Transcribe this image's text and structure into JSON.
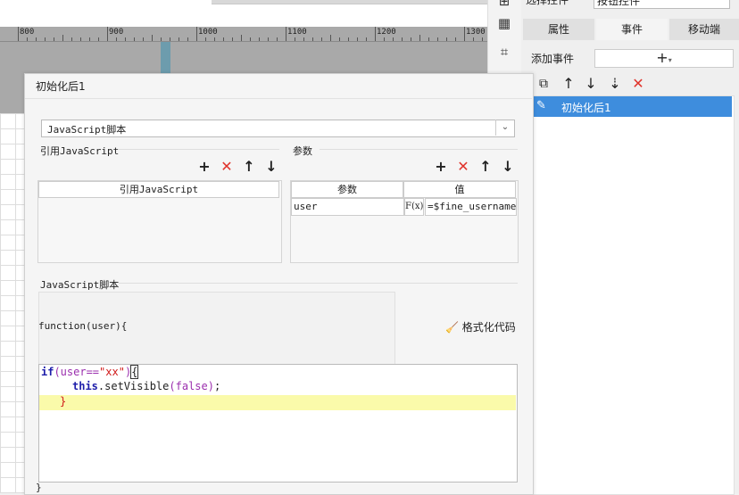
{
  "ruler": {
    "labels": [
      "800",
      "900",
      "1000",
      "1100",
      "1200",
      "1300"
    ]
  },
  "right_panel": {
    "top_select_left": "选择控件",
    "top_select_right": "按钮控件",
    "tabs": [
      {
        "label": "属性",
        "active": false
      },
      {
        "label": "事件",
        "active": true
      },
      {
        "label": "移动端",
        "active": false
      }
    ],
    "add_event_label": "添加事件",
    "add_event_button": "+",
    "event_toolbar": [
      "copy-icon",
      "arrow-up-icon",
      "arrow-down-icon",
      "sort-icon",
      "delete-icon"
    ],
    "events": [
      {
        "label": "初始化后1",
        "selected": true
      }
    ]
  },
  "dialog": {
    "title": "初始化后1",
    "type_select": "JavaScript脚本",
    "ref_js": {
      "label": "引用JavaScript",
      "column": "引用JavaScript"
    },
    "params": {
      "label": "参数",
      "columns": [
        "参数",
        "值"
      ],
      "rows": [
        {
          "name": "user",
          "fx": "F(x)",
          "value": "=$fine_username"
        }
      ]
    },
    "script": {
      "label": "JavaScript脚本",
      "header": "function(user){",
      "format_button": "格式化代码",
      "lines": {
        "l1_kw": "if",
        "l1_a": "(user==",
        "l1_str": "\"xx\"",
        "l1_b": ")",
        "l1_c": "{",
        "l2_kw": "this",
        "l2_a": ".setVisible",
        "l2_b": "(false)",
        "l2_c": ";",
        "l3": "}"
      },
      "footer": "}"
    }
  },
  "colors": {
    "accent": "#3e8ddd",
    "delete_red": "#e0332b",
    "highlight_line": "#fafaaa"
  }
}
